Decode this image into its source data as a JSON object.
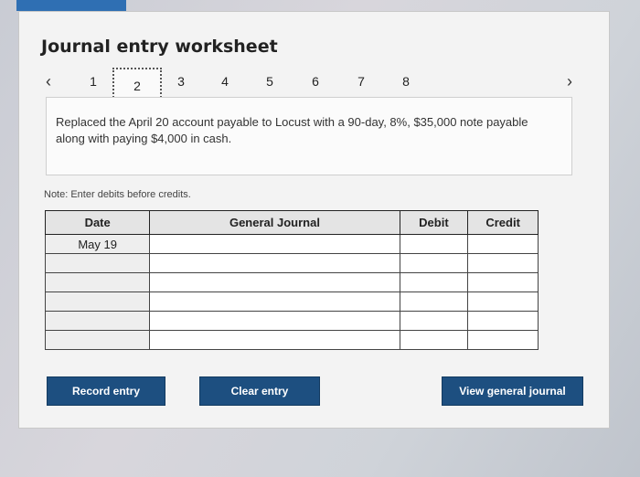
{
  "title": "Journal entry worksheet",
  "steps": [
    "1",
    "2",
    "3",
    "4",
    "5",
    "6",
    "7",
    "8"
  ],
  "active_step": "2",
  "prompt": "Replaced the April 20 account payable to Locust with a 90-day, 8%, $35,000 note payable along with paying $4,000 in cash.",
  "note": "Note: Enter debits before credits.",
  "table": {
    "headers": {
      "date": "Date",
      "general_journal": "General Journal",
      "debit": "Debit",
      "credit": "Credit"
    },
    "rows": [
      {
        "date": "May 19"
      },
      {
        "date": ""
      },
      {
        "date": ""
      },
      {
        "date": ""
      },
      {
        "date": ""
      },
      {
        "date": ""
      }
    ]
  },
  "buttons": {
    "record": "Record entry",
    "clear": "Clear entry",
    "view": "View general journal"
  },
  "colors": {
    "button_bg": "#1d4f80",
    "top_bar": "#2f6fb3"
  },
  "icons": {
    "prev": "chevron-left-icon",
    "next": "chevron-right-icon"
  }
}
